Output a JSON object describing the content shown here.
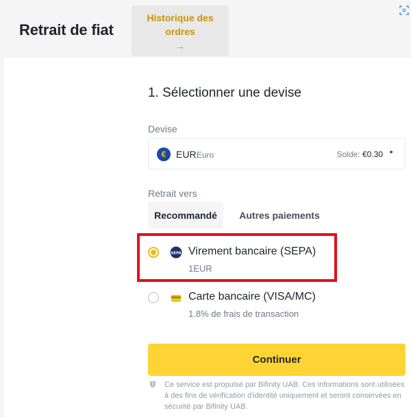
{
  "header": {
    "title": "Retrait de fiat",
    "history_button": {
      "label": "Historique des ordres",
      "arrow": "→"
    }
  },
  "step": {
    "title": "1. Sélectionner une devise"
  },
  "currency": {
    "label": "Devise",
    "code": "EUR",
    "name": "Euro",
    "icon_symbol": "€",
    "balance_label": "Solde:",
    "balance_value": "€0.30",
    "caret": "▸"
  },
  "withdraw_to": {
    "label": "Retrait vers",
    "tabs": [
      {
        "label": "Recommandé",
        "active": true
      },
      {
        "label": "Autres paiements",
        "active": false
      }
    ]
  },
  "payment_options": [
    {
      "title": "Virement bancaire (SEPA)",
      "subtitle": "1EUR",
      "selected": true,
      "icon": "sepa-icon"
    },
    {
      "title": "Carte bancaire (VISA/MC)",
      "subtitle": "1.8% de frais de transaction",
      "selected": false,
      "icon": "card-icon"
    }
  ],
  "continue_button": {
    "label": "Continuer"
  },
  "disclaimer": "Ce service est propulsé par Bifinity UAB. Ces informations sont utilisées à des fins de vérification d'identité uniquement et seront conservées en sécurité par Bifinity UAB.",
  "colors": {
    "accent": "#F0B90B",
    "button": "#FCD535",
    "history_text": "#C99400",
    "highlight": "#E0101A"
  }
}
